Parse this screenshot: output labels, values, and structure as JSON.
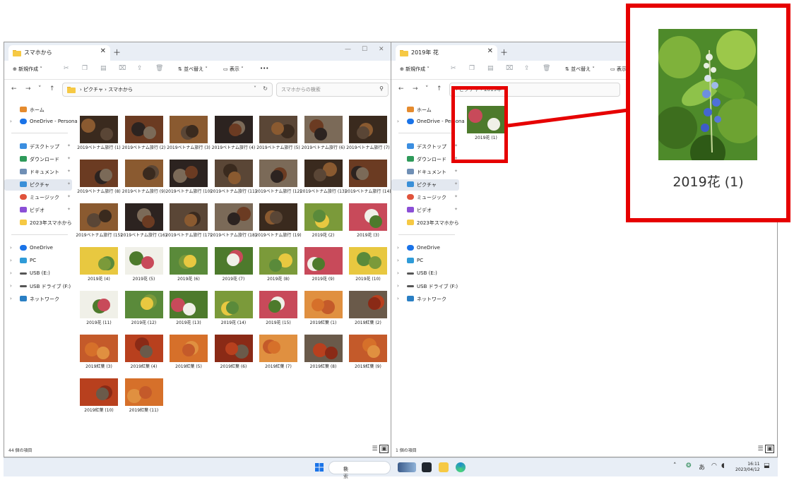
{
  "left_window": {
    "tab_title": "スマホから",
    "toolbar": {
      "new_label": "新規作成",
      "sort_label": "並べ替え",
      "view_label": "表示",
      "more_label": "•••"
    },
    "breadcrumb": {
      "path": "›  ピクチャ  ›  スマホから"
    },
    "search": {
      "placeholder": "スマホからの検索"
    },
    "status": "44 個の項目",
    "items": [
      "2019ベトナム旅行 (1)",
      "2019ベトナム旅行 (2)",
      "2019ベトナム旅行 (3)",
      "2019ベトナム旅行 (4)",
      "2019ベトナム旅行 (5)",
      "2019ベトナム旅行 (6)",
      "2019ベトナム旅行 (7)",
      "2019ベトナム旅行 (8)",
      "2019ベトナム旅行 (9)",
      "2019ベトナム旅行 (10)",
      "2019ベトナム旅行 (11)",
      "2019ベトナム旅行 (12)",
      "2019ベトナム旅行 (13)",
      "2019ベトナム旅行 (14)",
      "2019ベトナム旅行 (15)",
      "2019ベトナム旅行 (16)",
      "2019ベトナム旅行 (17)",
      "2019ベトナム旅行 (18)",
      "2019ベトナム旅行 (19)",
      "2019花 (2)",
      "2019花 (3)",
      "2019花 (4)",
      "2019花 (5)",
      "2019花 (6)",
      "2019花 (7)",
      "2019花 (8)",
      "2019花 (9)",
      "2019花 (10)",
      "2019花 (11)",
      "2019花 (12)",
      "2019花 (13)",
      "2019花 (14)",
      "2019花 (15)",
      "2019紅葉 (1)",
      "2019紅葉 (2)",
      "2019紅葉 (3)",
      "2019紅葉 (4)",
      "2019紅葉 (5)",
      "2019紅葉 (6)",
      "2019紅葉 (7)",
      "2019紅葉 (8)",
      "2019紅葉 (9)",
      "2019紅葉 (10)",
      "2019紅葉 (11)"
    ]
  },
  "right_window": {
    "tab_title": "2019年 花",
    "toolbar": {
      "new_label": "新規作成",
      "sort_label": "並べ替え",
      "view_label": "表示"
    },
    "breadcrumb": {
      "path": "›  ピクチャ  ›  2019年"
    },
    "status": "1 個の項目",
    "items": [
      "2019花 (1)"
    ]
  },
  "sidebar": {
    "home": "ホーム",
    "onedrive_personal": "OneDrive - Persona",
    "desktop": "デスクトップ",
    "downloads": "ダウンロード",
    "documents": "ドキュメント",
    "pictures": "ピクチャ",
    "music": "ミュージック",
    "videos": "ビデオ",
    "folder_2023": "2023年スマホから",
    "onedrive": "OneDrive",
    "pc": "PC",
    "usb_e": "USB (E:)",
    "usb_drive_f": "USB ドライブ (F:)",
    "network": "ネットワーク"
  },
  "taskbar": {
    "search_label": "検索",
    "time": "16:11",
    "date": "2023/04/12",
    "ime": "あ"
  },
  "callout": {
    "caption": "2019花 (1)"
  }
}
